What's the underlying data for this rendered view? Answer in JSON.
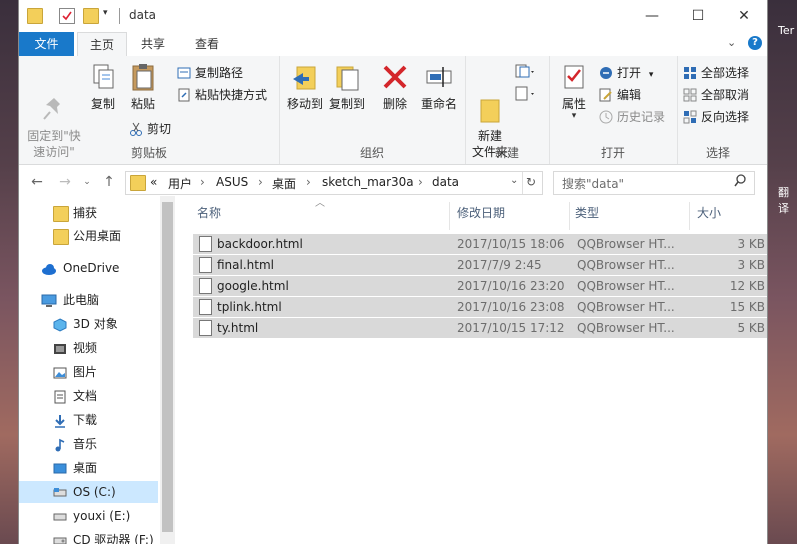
{
  "window": {
    "title": "data"
  },
  "desktop": {
    "top_right_text": "Ter",
    "right_text": "翻译"
  },
  "tabs": [
    {
      "label": "文件"
    },
    {
      "label": "主页"
    },
    {
      "label": "共享"
    },
    {
      "label": "查看"
    }
  ],
  "ribbon": {
    "clipboard": {
      "group_label": "剪贴板",
      "pin_quick_access": "固定到\"快\n速访问\"",
      "copy": "复制",
      "paste": "粘贴",
      "copy_path": "复制路径",
      "paste_shortcut": "粘贴快捷方式",
      "cut": "剪切"
    },
    "organize": {
      "group_label": "组织",
      "move_to": "移动到",
      "copy_to": "复制到",
      "delete": "删除",
      "rename": "重命名"
    },
    "new": {
      "group_label": "新建",
      "new_folder": "新建\n文件夹"
    },
    "open": {
      "group_label": "打开",
      "properties": "属性",
      "open": "打开",
      "edit": "编辑",
      "history": "历史记录"
    },
    "select": {
      "group_label": "选择",
      "select_all": "全部选择",
      "select_none": "全部取消",
      "invert": "反向选择"
    }
  },
  "address": {
    "crumbs": [
      "«",
      "用户",
      "ASUS",
      "桌面",
      "sketch_mar30a",
      "data"
    ],
    "search_placeholder": "搜索\"data\""
  },
  "nav": [
    {
      "label": "捕获",
      "icon": "folder-icon"
    },
    {
      "label": "公用桌面",
      "icon": "folder-icon"
    },
    {
      "label": "OneDrive",
      "icon": "cloud-icon"
    },
    {
      "label": "此电脑",
      "icon": "computer-icon"
    },
    {
      "label": "3D 对象",
      "icon": "cube-icon"
    },
    {
      "label": "视频",
      "icon": "video-icon"
    },
    {
      "label": "图片",
      "icon": "picture-icon"
    },
    {
      "label": "文档",
      "icon": "document-icon"
    },
    {
      "label": "下载",
      "icon": "download-icon"
    },
    {
      "label": "音乐",
      "icon": "music-icon"
    },
    {
      "label": "桌面",
      "icon": "desktop-icon"
    },
    {
      "label": "OS (C:)",
      "icon": "drive-icon"
    },
    {
      "label": "youxi (E:)",
      "icon": "drive-icon"
    },
    {
      "label": "CD 驱动器 (F:)",
      "icon": "cd-drive-icon"
    }
  ],
  "columns": {
    "name": "名称",
    "modified": "修改日期",
    "type": "类型",
    "size": "大小"
  },
  "files": [
    {
      "name": "backdoor.html",
      "modified": "2017/10/15 18:06",
      "type": "QQBrowser HT...",
      "size": "3 KB"
    },
    {
      "name": "final.html",
      "modified": "2017/7/9 2:45",
      "type": "QQBrowser HT...",
      "size": "3 KB"
    },
    {
      "name": "google.html",
      "modified": "2017/10/16 23:20",
      "type": "QQBrowser HT...",
      "size": "12 KB"
    },
    {
      "name": "tplink.html",
      "modified": "2017/10/16 23:08",
      "type": "QQBrowser HT...",
      "size": "15 KB"
    },
    {
      "name": "ty.html",
      "modified": "2017/10/15 17:12",
      "type": "QQBrowser HT...",
      "size": "5 KB"
    }
  ],
  "colors": {
    "accent": "#1979ca",
    "selection": "#d9d9d9",
    "nav_selected": "#cce8ff"
  }
}
